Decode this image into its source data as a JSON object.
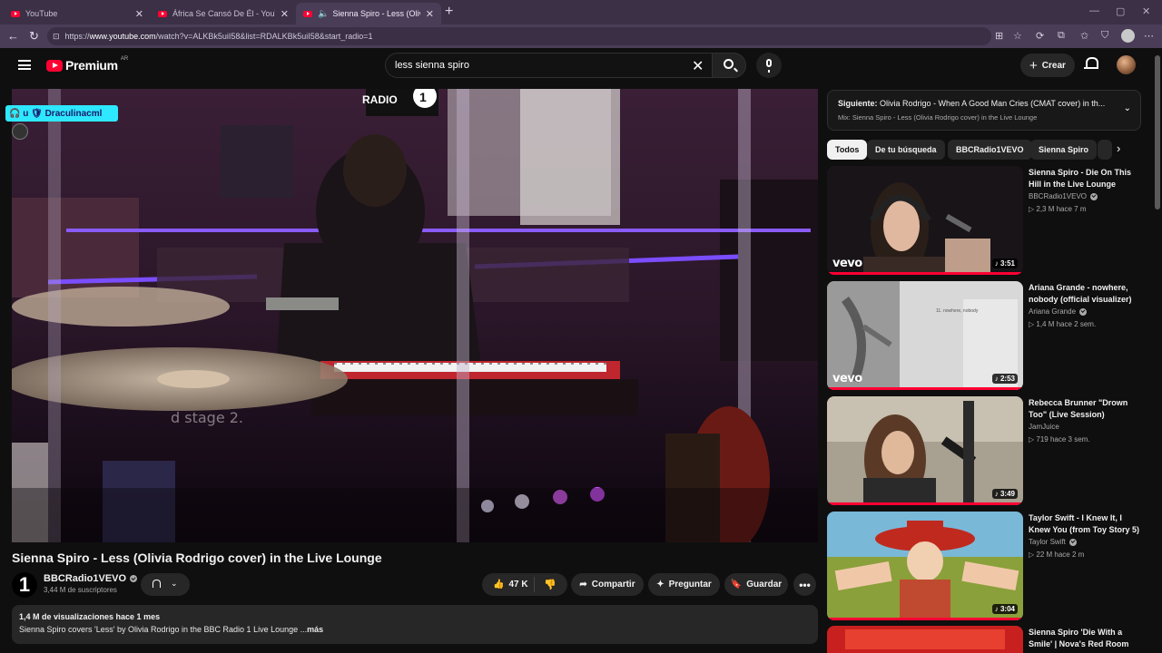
{
  "browser": {
    "tabs": [
      {
        "title": "YouTube"
      },
      {
        "title": "África Se Cansó De Él - YouTube"
      },
      {
        "title": "Sienna Spiro - Less (Olivia Rod"
      }
    ],
    "url_prefix": "https://",
    "url_host": "www.youtube.com",
    "url_path": "/watch?v=ALKBk5uiI58&list=RDALKBk5uiI58&start_radio=1"
  },
  "header": {
    "logo_text": "Premium",
    "country_code": "AR",
    "search_value": "less sienna spiro",
    "create_label": "Crear"
  },
  "player": {
    "overlay_tag": "🎧 u 🛡 Draculinacml"
  },
  "video": {
    "title": "Sienna Spiro - Less (Olivia Rodrigo cover) in the Live Lounge",
    "channel_logo": "1",
    "channel_name": "BBCRadio1VEVO",
    "subscribers": "3,44 M de suscriptores",
    "likes": "47 K",
    "share_label": "Compartir",
    "ask_label": "Preguntar",
    "save_label": "Guardar",
    "views_meta": "1,4 M de visualizaciones  hace 1 mes",
    "description": "Sienna Spiro covers 'Less' by Olivia Rodrigo in the BBC Radio 1 Live Lounge ...",
    "more_label": "más"
  },
  "up_next": {
    "label": "Siguiente:",
    "title": "Olivia Rodrigo - When A Good Man Cries (CMAT cover) in th...",
    "mix": "Mix: Sienna Spiro - Less (Olivia Rodrigo cover) in the Live Lounge"
  },
  "chips": [
    "Todos",
    "De tu búsqueda",
    "BBCRadio1VEVO",
    "Sienna Spiro"
  ],
  "recommendations": [
    {
      "title": "Sienna Spiro - Die On This Hill in the Live Lounge",
      "channel": "BBCRadio1VEVO",
      "meta": "2,3 M   hace 7 m",
      "duration": "3:51",
      "vevo": "vevo"
    },
    {
      "title": "Ariana Grande - nowhere, nobody (official visualizer)",
      "channel": "Ariana Grande",
      "meta": "1,4 M   hace 2 sem.",
      "duration": "2:53",
      "vevo": "vevo",
      "thumb_text": "11. nowhere, nobody"
    },
    {
      "title": "Rebecca Brunner \"Drown Too\" (Live Session)",
      "channel": "JamJuice",
      "meta": "719   hace 3 sem.",
      "duration": "3:49"
    },
    {
      "title": "Taylor Swift - I Knew It, I Knew You (from Toy Story 5)",
      "channel": "Taylor Swift",
      "meta": "22 M   hace 2 m",
      "duration": "3:04"
    },
    {
      "title": "Sienna Spiro 'Die With a Smile' | Nova's Red Room"
    }
  ]
}
